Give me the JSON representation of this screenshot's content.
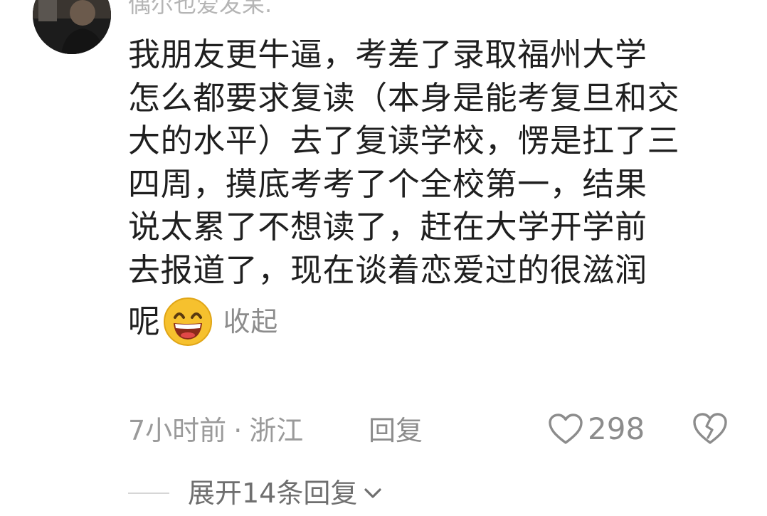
{
  "comment": {
    "username": "偶尔也爱发呆.",
    "lines": [
      "我朋友更牛逼，考差了录取福州大学",
      "怎么都要求复读（本身是能考复旦和交",
      "大的水平）去了复读学校，愣是扛了三",
      "四周，摸底考考了个全校第一，结果",
      "说太累了不想读了，赶在大学开学前",
      "去报道了，现在谈着恋爱过的很滋润",
      "呢"
    ],
    "emoji_icon": "grinning-face-emoji",
    "collapse_label": "收起"
  },
  "meta": {
    "time": "7小时前",
    "separator": "·",
    "location": "浙江",
    "reply_label": "回复"
  },
  "actions": {
    "like_icon": "heart-outline-icon",
    "like_count": "298",
    "dislike_icon": "broken-heart-icon"
  },
  "replies": {
    "expand_label": "展开14条回复",
    "chevron_icon": "chevron-down-icon"
  },
  "colors": {
    "text": "#1f1f1f",
    "muted": "#9a9a9a",
    "divider": "#d6d6d6",
    "emoji_face": "#f6c12e"
  }
}
